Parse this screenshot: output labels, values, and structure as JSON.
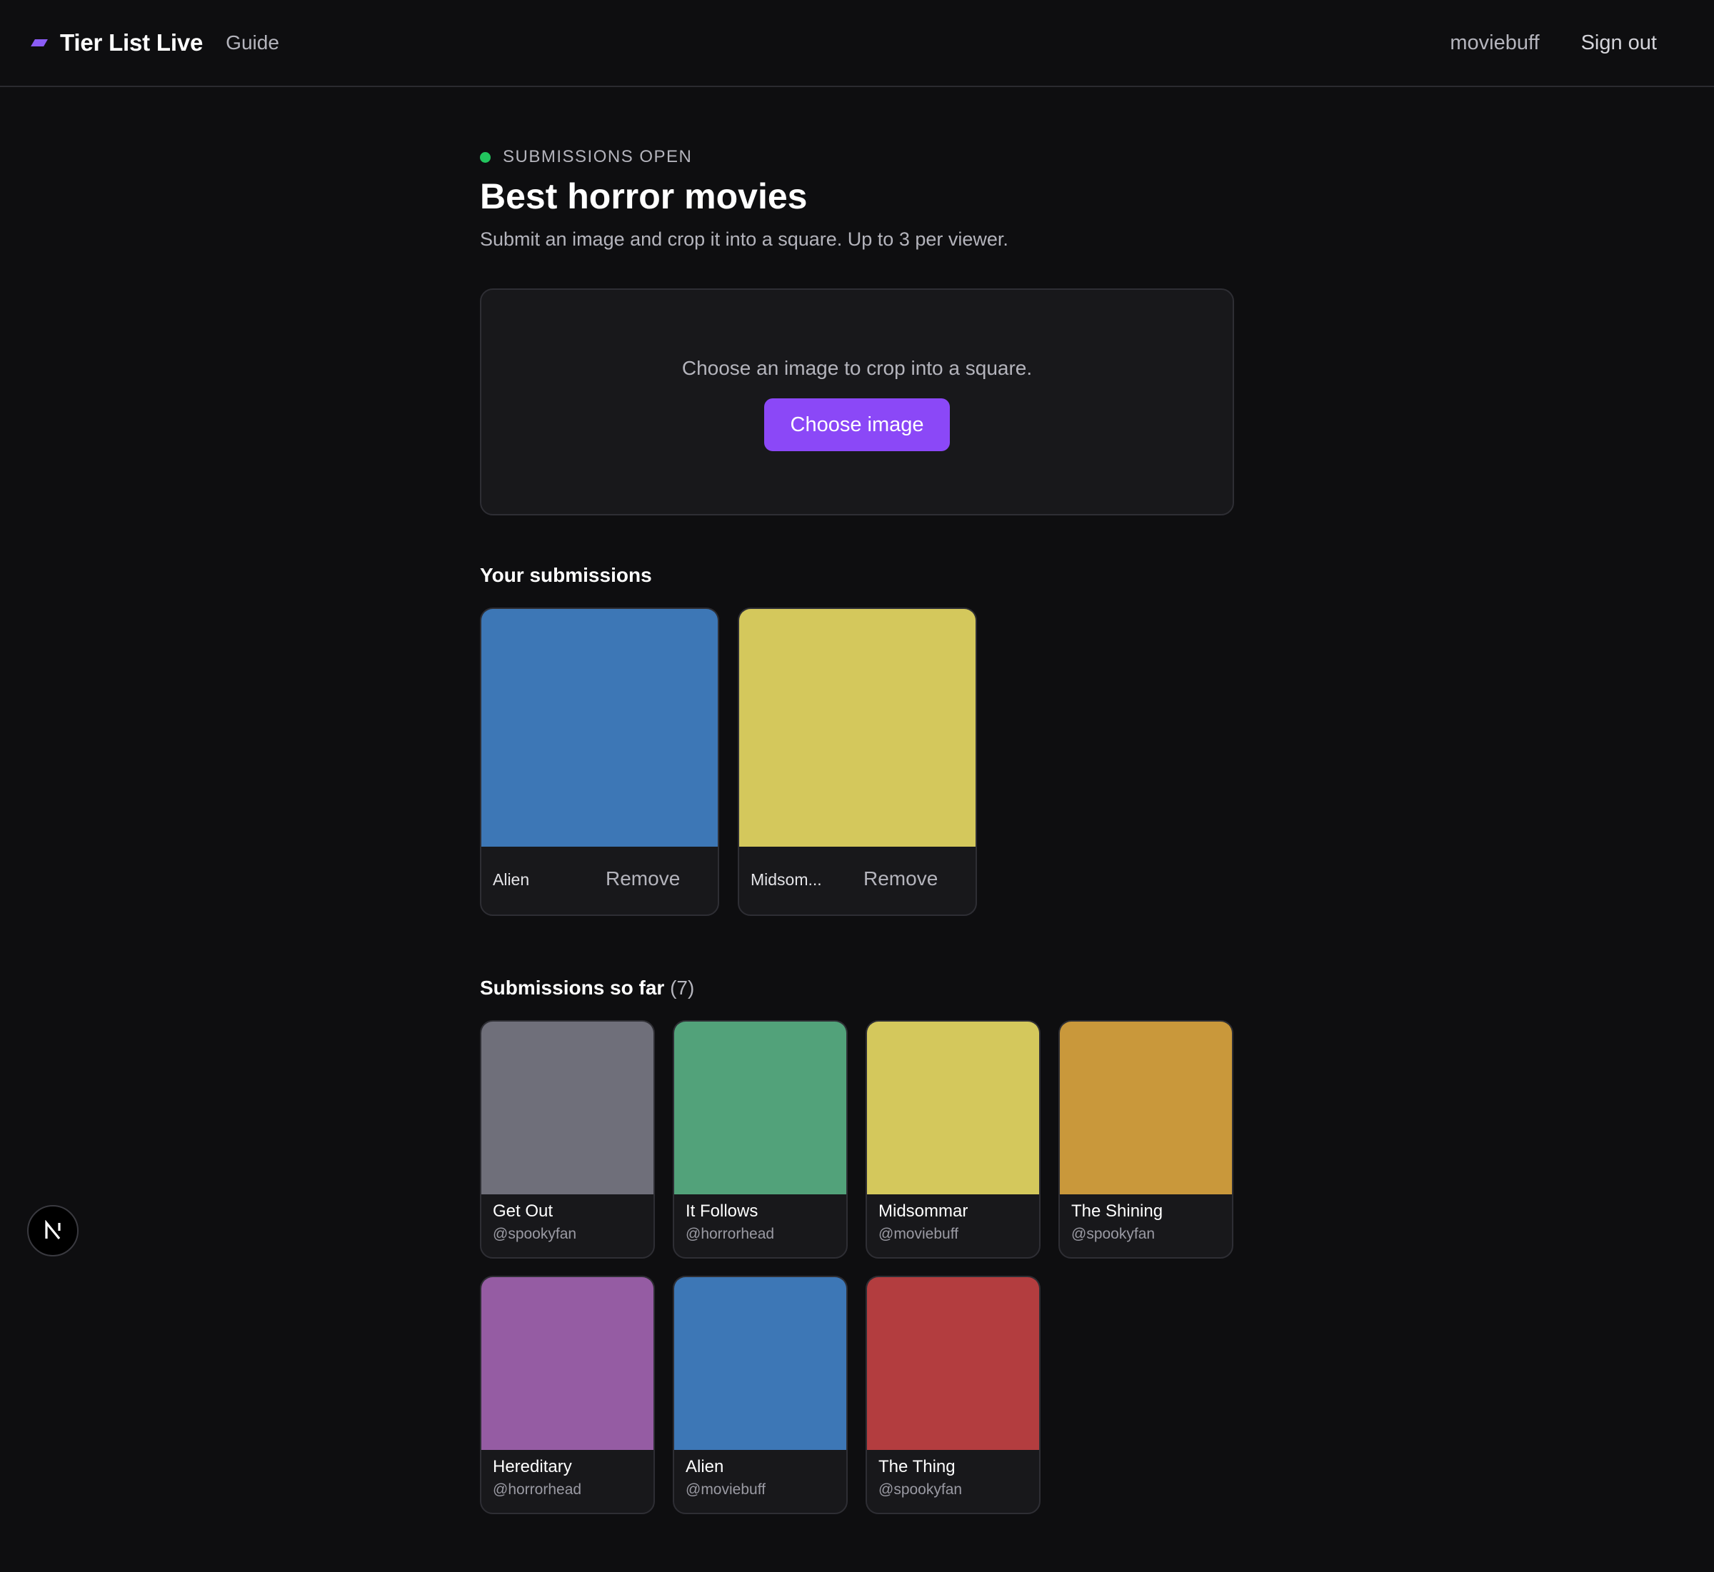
{
  "header": {
    "brand": "Tier List Live",
    "guide_link": "Guide",
    "username": "moviebuff",
    "sign_out": "Sign out",
    "accent_color": "#8b5cf6"
  },
  "status": {
    "text": "SUBMISSIONS OPEN",
    "color": "#22c55e"
  },
  "page": {
    "title": "Best horror movies",
    "subtitle": "Submit an image and crop it into a square. Up to 3 per viewer."
  },
  "upload": {
    "prompt": "Choose an image to crop into a square.",
    "button_label": "Choose image"
  },
  "your_submissions": {
    "heading": "Your submissions",
    "items": [
      {
        "name": "Alien",
        "display_name": "Alien",
        "remove_label": "Remove",
        "color": "#3d77b6"
      },
      {
        "name": "Midsommar",
        "display_name": "Midsom...",
        "remove_label": "Remove",
        "color": "#d4c85c"
      }
    ]
  },
  "all_submissions": {
    "heading": "Submissions so far",
    "count": "(7)",
    "items": [
      {
        "title": "Get Out",
        "user": "@spookyfan",
        "color": "#6f6f7a"
      },
      {
        "title": "It Follows",
        "user": "@horrorhead",
        "color": "#52a27a"
      },
      {
        "title": "Midsommar",
        "user": "@moviebuff",
        "color": "#d4c85c"
      },
      {
        "title": "The Shining",
        "user": "@spookyfan",
        "color": "#c9983b"
      },
      {
        "title": "Hereditary",
        "user": "@horrorhead",
        "color": "#955ca3"
      },
      {
        "title": "Alien",
        "user": "@moviebuff",
        "color": "#3d77b6"
      },
      {
        "title": "The Thing",
        "user": "@spookyfan",
        "color": "#b33d3f"
      }
    ]
  },
  "dev_badge": {
    "icon": "nextjs-icon"
  }
}
